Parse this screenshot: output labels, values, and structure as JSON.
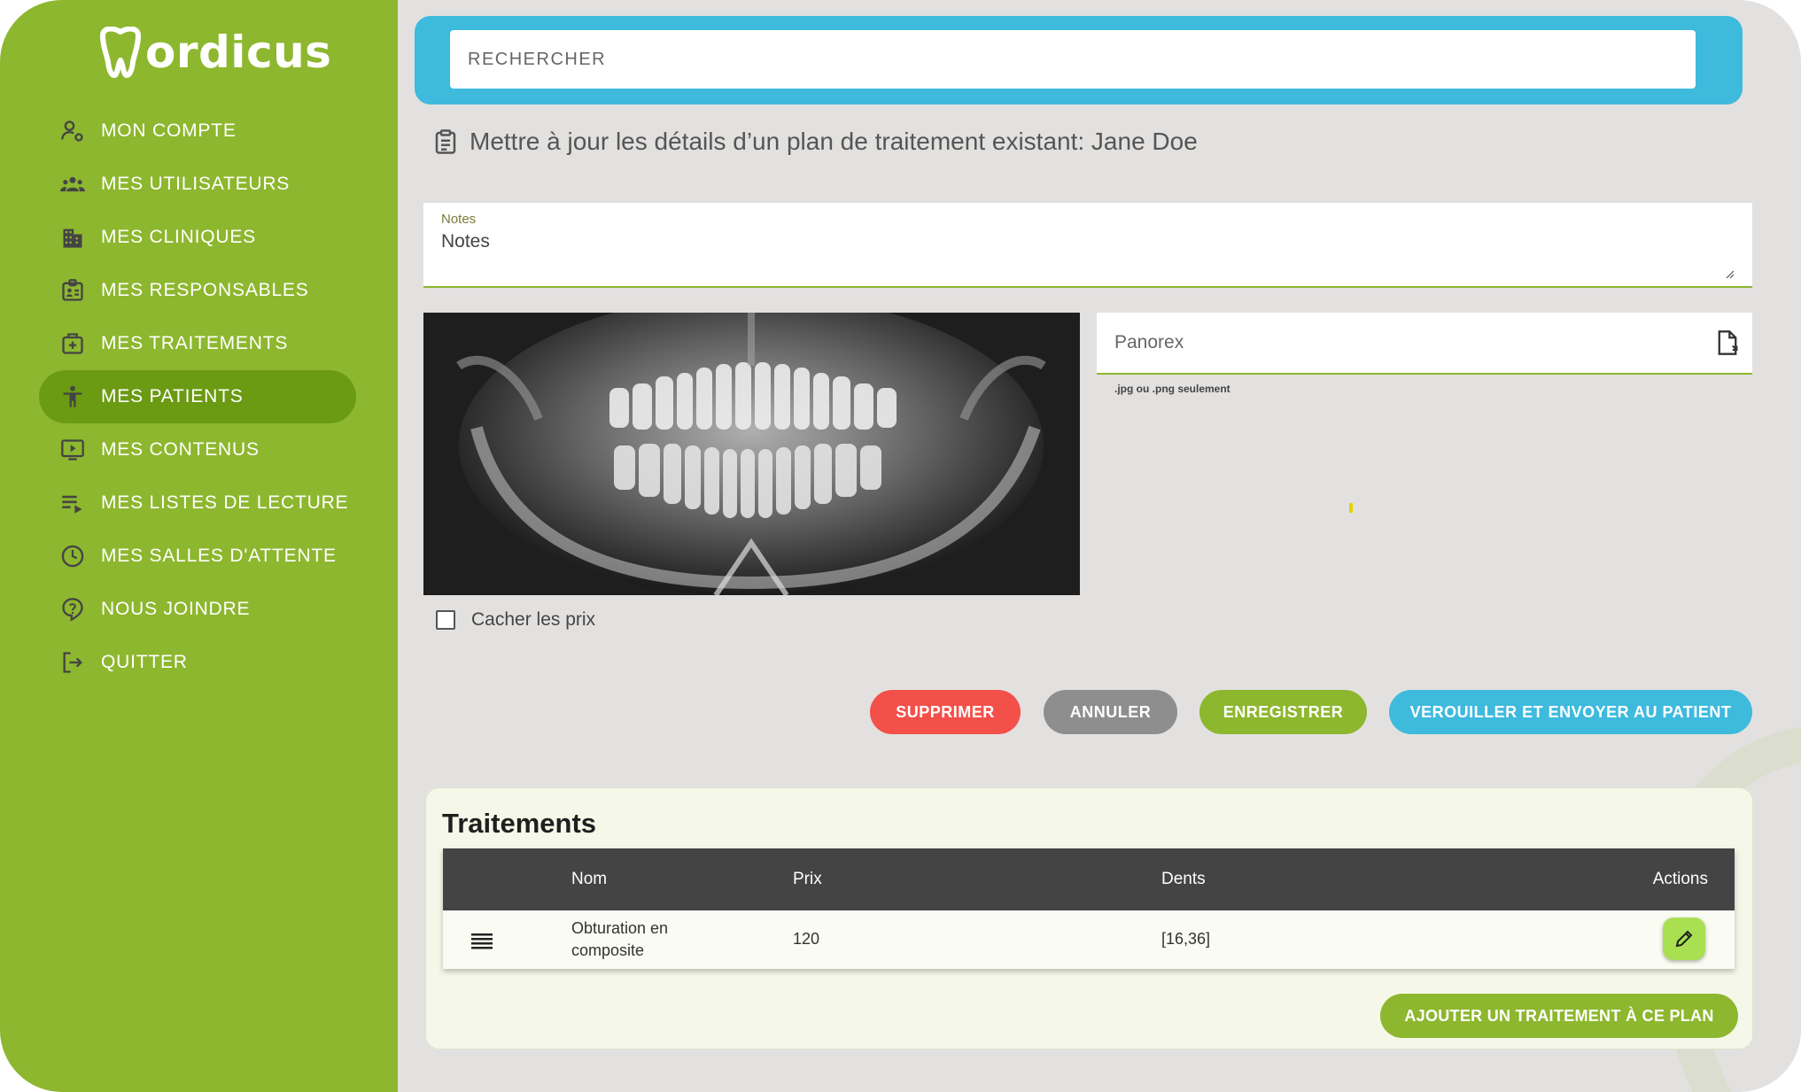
{
  "brand": {
    "logo_text": "ordicus"
  },
  "sidebar": {
    "items": [
      {
        "label": "MON COMPTE",
        "icon": "account-settings-icon"
      },
      {
        "label": "MES UTILISATEURS",
        "icon": "users-icon"
      },
      {
        "label": "MES CLINIQUES",
        "icon": "building-icon"
      },
      {
        "label": "MES RESPONSABLES",
        "icon": "badge-icon"
      },
      {
        "label": "MES TRAITEMENTS",
        "icon": "medical-bag-icon"
      },
      {
        "label": "MES PATIENTS",
        "icon": "person-icon",
        "active": true
      },
      {
        "label": "MES CONTENUS",
        "icon": "play-screen-icon"
      },
      {
        "label": "MES LISTES DE LECTURE",
        "icon": "playlist-icon"
      },
      {
        "label": "MES SALLES D'ATTENTE",
        "icon": "clock-icon"
      },
      {
        "label": "NOUS JOINDRE",
        "icon": "help-bubble-icon"
      },
      {
        "label": "QUITTER",
        "icon": "logout-icon"
      }
    ]
  },
  "search": {
    "placeholder": "RECHERCHER"
  },
  "page": {
    "heading": "Mettre à jour les détails d’un plan de traitement existant: Jane Doe"
  },
  "form": {
    "notes_label": "Notes",
    "notes_value": "Notes",
    "file_placeholder": "Panorex",
    "file_hint": ".jpg ou .png seulement",
    "hide_prices_label": "Cacher les prix"
  },
  "actions": {
    "delete": "SUPPRIMER",
    "cancel": "ANNULER",
    "save": "ENREGISTRER",
    "lock_send": "VEROUILLER ET ENVOYER AU PATIENT"
  },
  "treatments": {
    "title": "Traitements",
    "columns": {
      "name": "Nom",
      "price": "Prix",
      "teeth": "Dents",
      "actions": "Actions"
    },
    "rows": [
      {
        "name": "Obturation en composite",
        "price": "120",
        "teeth": "[16,36]"
      }
    ],
    "add_button": "AJOUTER UN TRAITEMENT À CE PLAN"
  },
  "colors": {
    "sidebar": "#8db72e",
    "sidebar_active": "#6b9a13",
    "search_bar": "#3ebadd",
    "delete": "#f4504a",
    "cancel": "#8e8e8e",
    "save": "#8db72e",
    "lock": "#3ebadd",
    "edit": "#a8e052"
  }
}
